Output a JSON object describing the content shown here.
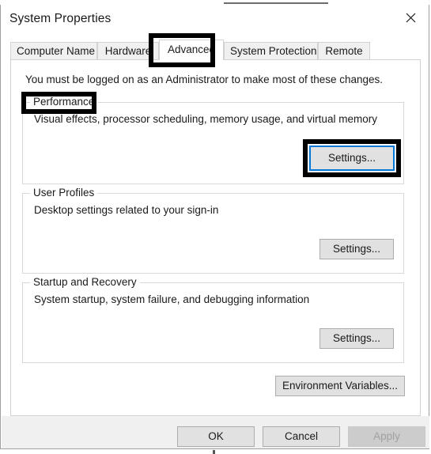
{
  "window": {
    "title": "System Properties",
    "close_icon": "close-icon"
  },
  "tabs": [
    {
      "label": "Computer Name",
      "selected": false
    },
    {
      "label": "Hardware",
      "selected": false
    },
    {
      "label": "Advanced",
      "selected": true
    },
    {
      "label": "System Protection",
      "selected": false
    },
    {
      "label": "Remote",
      "selected": false
    }
  ],
  "page": {
    "admin_note": "You must be logged on as an Administrator to make most of these changes.",
    "groups": [
      {
        "legend": "Performance",
        "description": "Visual effects, processor scheduling, memory usage, and virtual memory",
        "button_label": "Settings...",
        "focused": true,
        "highlighted": true
      },
      {
        "legend": "User Profiles",
        "description": "Desktop settings related to your sign-in",
        "button_label": "Settings...",
        "focused": false,
        "highlighted": false
      },
      {
        "legend": "Startup and Recovery",
        "description": "System startup, system failure, and debugging information",
        "button_label": "Settings...",
        "focused": false,
        "highlighted": false
      }
    ],
    "environment_variables_label": "Environment Variables..."
  },
  "footer": {
    "ok_label": "OK",
    "cancel_label": "Cancel",
    "apply_label": "Apply",
    "apply_disabled": true
  },
  "annotations": {
    "highlight_color": "#000000",
    "focus_color": "#0078d7",
    "targets": [
      "Advanced",
      "Performance",
      "Settings..."
    ]
  }
}
